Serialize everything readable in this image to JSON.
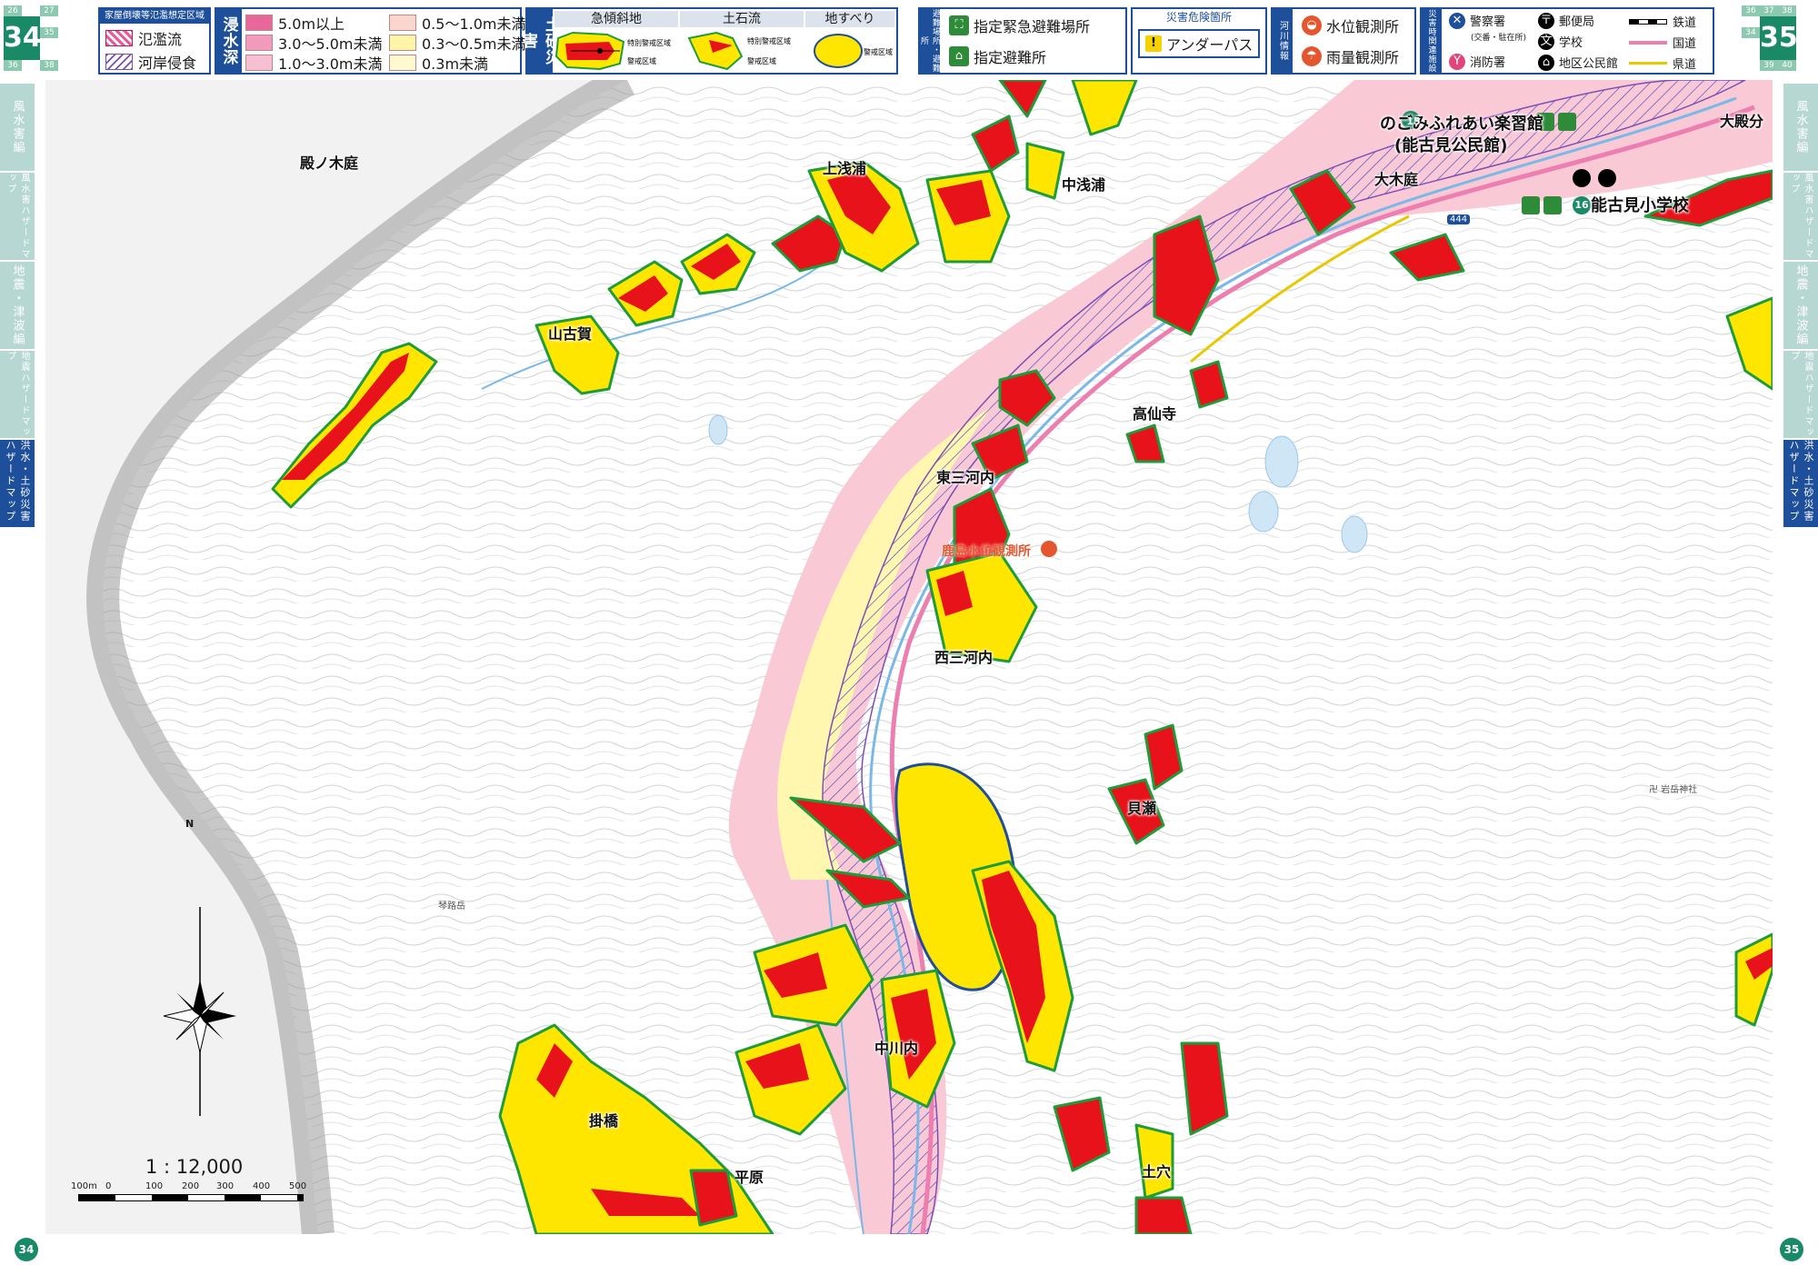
{
  "page_tabs": {
    "left": {
      "main": "34",
      "cells": [
        "26",
        "27",
        "35",
        "36",
        "38"
      ]
    },
    "right": {
      "main": "35",
      "cells": [
        "36",
        "37",
        "38",
        "34",
        "39",
        "40"
      ]
    }
  },
  "legend": {
    "house_collapse": {
      "title": "家屋倒壊等氾濫想定区域",
      "items": [
        "氾濫流",
        "河岸侵食"
      ]
    },
    "inundation": {
      "title": "浸水深",
      "items": [
        {
          "label": "5.0m以上",
          "color": "#e9679a"
        },
        {
          "label": "3.0〜5.0m未満",
          "color": "#f29bbc"
        },
        {
          "label": "1.0〜3.0m未満",
          "color": "#f7bfd3"
        },
        {
          "label": "0.5〜1.0m未満",
          "color": "#fbd6cf"
        },
        {
          "label": "0.3〜0.5m未満",
          "color": "#fff5a6"
        },
        {
          "label": "0.3m未満",
          "color": "#fff9cf"
        }
      ]
    },
    "sediment": {
      "title": "土砂災害",
      "columns": [
        "急傾斜地",
        "土石流",
        "地すべり"
      ],
      "steep_labels": [
        "特別警戒区域",
        "警戒区域"
      ],
      "debris_labels": [
        "特別警戒区域",
        "警戒区域"
      ],
      "landslide_label": "警戒区域",
      "colors": {
        "special": "#e8131a",
        "warning": "#ffe600",
        "outline": "#1f9c3a"
      }
    },
    "evacuation": {
      "title": "避難場所・避難所",
      "items": [
        "指定緊急避難場所",
        "指定避難所"
      ]
    },
    "danger_spot": {
      "title": "災害危険箇所",
      "item": "アンダーパス"
    },
    "river": {
      "title": "河川情報",
      "items": [
        "水位観測所",
        "雨量観測所"
      ]
    },
    "facilities": {
      "title": "災害時関連施設",
      "items": [
        "警察署",
        "(交番・駐在所)",
        "消防署",
        "郵便局",
        "学校",
        "地区公民館",
        "鉄道",
        "国道",
        "県道"
      ]
    }
  },
  "side_tabs": {
    "left": [
      "風水害編",
      "風水害ハザードマップ",
      "地震・津波編",
      "地震ハザードマップ",
      "洪水・土砂災害ハザードマップ"
    ],
    "right": [
      "風水害編",
      "風水害ハザードマップ",
      "地震・津波編",
      "地震ハザードマップ",
      "洪水・土砂災害ハザードマップ"
    ]
  },
  "place_names": [
    "殿ノ木庭",
    "上浅浦",
    "中浅浦",
    "山古賀",
    "大木庭",
    "大殿分",
    "高仙寺",
    "東三河内",
    "西三河内",
    "貝瀬",
    "中川内",
    "掛橋",
    "平原",
    "土穴"
  ],
  "facilities_on_map": {
    "shelter_15": {
      "number": "15",
      "name": "のごみふれあい楽習館",
      "sub": "(能古見公民館)"
    },
    "shelter_16": {
      "number": "16",
      "name": "能古見小学校"
    },
    "water_station": "鹿島水位観測所",
    "route_number": "444",
    "mountain": "琴路岳",
    "shrine": "卍 岩岳神社"
  },
  "scale": {
    "ratio": "1 : 12,000",
    "ticks": [
      "100m",
      "0",
      "100",
      "200",
      "300",
      "400",
      "500"
    ]
  },
  "north_label": "N",
  "page_numbers": {
    "left": "34",
    "right": "35"
  }
}
